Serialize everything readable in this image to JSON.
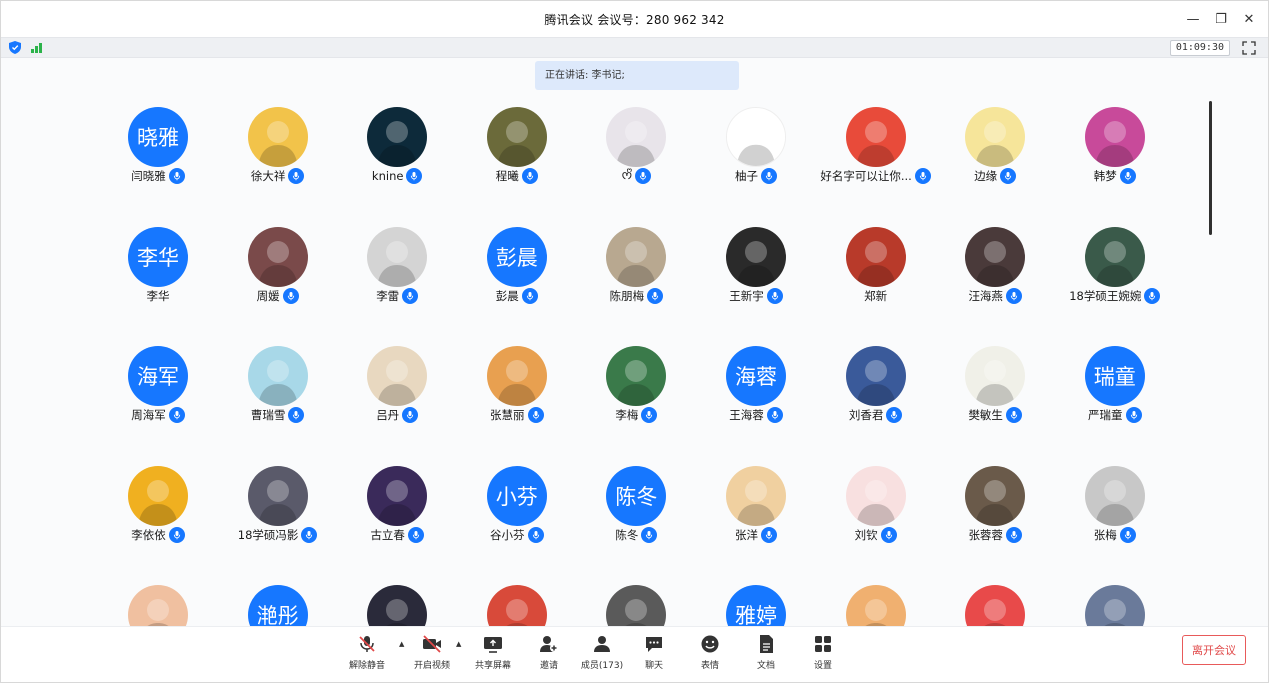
{
  "window": {
    "title": "腾讯会议 会议号：280 962 342"
  },
  "status": {
    "timer": "01:09:30"
  },
  "speaking": {
    "text": "正在讲话: 李书记;"
  },
  "participants": [
    {
      "name": "闫晓雅",
      "avatar_text": "晓雅",
      "mic": true
    },
    {
      "name": "徐大祥",
      "avatar_text": "",
      "photo": "#f2c34a",
      "mic": true
    },
    {
      "name": "knine",
      "avatar_text": "",
      "photo": "#0d2a3a",
      "mic": true
    },
    {
      "name": "程曦",
      "avatar_text": "",
      "photo": "#6b6a3a",
      "mic": true
    },
    {
      "name": "ᰔᩚ",
      "avatar_text": "",
      "photo": "#e8e4ea",
      "mic": true
    },
    {
      "name": "柚子",
      "avatar_text": "",
      "photo": "#ffffff",
      "mic": true
    },
    {
      "name": "好名字可以让你...",
      "avatar_text": "",
      "photo": "#e84b3a",
      "mic": true
    },
    {
      "name": "边缘",
      "avatar_text": "",
      "photo": "#f6e59a",
      "mic": true
    },
    {
      "name": "韩梦",
      "avatar_text": "",
      "photo": "#c84a9a",
      "mic": true
    },
    {
      "name": "李华",
      "avatar_text": "李华",
      "mic": false
    },
    {
      "name": "周媛",
      "avatar_text": "",
      "photo": "#7a4a4a",
      "mic": true
    },
    {
      "name": "李雷",
      "avatar_text": "",
      "photo": "#d4d4d4",
      "mic": true
    },
    {
      "name": "彭晨",
      "avatar_text": "彭晨",
      "mic": true
    },
    {
      "name": "陈朋梅",
      "avatar_text": "",
      "photo": "#b8a890",
      "mic": true
    },
    {
      "name": "王新宇",
      "avatar_text": "",
      "photo": "#2a2a2a",
      "mic": true
    },
    {
      "name": "郑新",
      "avatar_text": "",
      "photo": "#b83a2a",
      "mic": false
    },
    {
      "name": "汪海燕",
      "avatar_text": "",
      "photo": "#4a3a3a",
      "mic": true
    },
    {
      "name": "18学硕王婉婉",
      "avatar_text": "",
      "photo": "#3a5a4a",
      "mic": true
    },
    {
      "name": "周海军",
      "avatar_text": "海军",
      "mic": true
    },
    {
      "name": "曹瑞雪",
      "avatar_text": "",
      "photo": "#a8d8e8",
      "mic": true
    },
    {
      "name": "吕丹",
      "avatar_text": "",
      "photo": "#e8d8c0",
      "mic": true
    },
    {
      "name": "张慧丽",
      "avatar_text": "",
      "photo": "#e8a050",
      "mic": true
    },
    {
      "name": "李梅",
      "avatar_text": "",
      "photo": "#3a7a4a",
      "mic": true
    },
    {
      "name": "王海蓉",
      "avatar_text": "海蓉",
      "mic": true
    },
    {
      "name": "刘香君",
      "avatar_text": "",
      "photo": "#3a5a9a",
      "mic": true
    },
    {
      "name": "樊敏生",
      "avatar_text": "",
      "photo": "#f0f0e8",
      "mic": true
    },
    {
      "name": "严瑞童",
      "avatar_text": "瑞童",
      "mic": true
    },
    {
      "name": "李依依",
      "avatar_text": "",
      "photo": "#f0b020",
      "mic": true
    },
    {
      "name": "18学硕冯影",
      "avatar_text": "",
      "photo": "#5a5a6a",
      "mic": true
    },
    {
      "name": "古立春",
      "avatar_text": "",
      "photo": "#3a2a5a",
      "mic": true
    },
    {
      "name": "谷小芬",
      "avatar_text": "小芬",
      "mic": true
    },
    {
      "name": "陈冬",
      "avatar_text": "陈冬",
      "mic": true
    },
    {
      "name": "张洋",
      "avatar_text": "",
      "photo": "#f0d0a0",
      "mic": true
    },
    {
      "name": "刘钦",
      "avatar_text": "",
      "photo": "#f8e0e0",
      "mic": true
    },
    {
      "name": "张蓉蓉",
      "avatar_text": "",
      "photo": "#6a5a4a",
      "mic": true
    },
    {
      "name": "张梅",
      "avatar_text": "",
      "photo": "#c8c8c8",
      "mic": true
    },
    {
      "name": "",
      "avatar_text": "",
      "photo": "#f0c0a0",
      "mic": false
    },
    {
      "name": "",
      "avatar_text": "滟彤",
      "mic": false
    },
    {
      "name": "",
      "avatar_text": "",
      "photo": "#2a2a3a",
      "mic": false
    },
    {
      "name": "",
      "avatar_text": "",
      "photo": "#d84a3a",
      "mic": false
    },
    {
      "name": "",
      "avatar_text": "",
      "photo": "#5a5a5a",
      "mic": false
    },
    {
      "name": "",
      "avatar_text": "雅婷",
      "mic": false
    },
    {
      "name": "",
      "avatar_text": "",
      "photo": "#f0b070",
      "mic": false
    },
    {
      "name": "",
      "avatar_text": "",
      "photo": "#e84a4a",
      "mic": false
    },
    {
      "name": "",
      "avatar_text": "",
      "photo": "#6a7a9a",
      "mic": false
    }
  ],
  "toolbar": {
    "unmute": "解除静音",
    "video": "开启视频",
    "share": "共享屏幕",
    "invite": "邀请",
    "members": "成员(173)",
    "chat": "聊天",
    "emoji": "表情",
    "docs": "文档",
    "settings": "设置",
    "leave": "离开会议"
  },
  "colors": {
    "accent": "#1677ff",
    "leave": "#e04848",
    "signal": "#2bb34a"
  }
}
